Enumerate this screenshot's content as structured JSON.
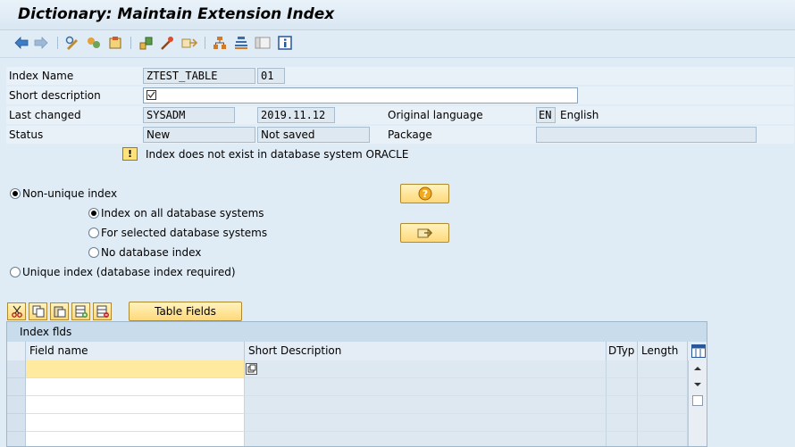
{
  "window": {
    "title": "Dictionary: Maintain Extension Index"
  },
  "toolbar": {
    "icons": [
      "back-icon",
      "forward-icon",
      "display-change-icon",
      "other-object-icon",
      "active-inactive-icon",
      "check-icon",
      "activate-icon",
      "where-used-icon",
      "object-list-icon",
      "navigation-window-icon",
      "display-toggle-icon",
      "info-icon"
    ]
  },
  "form": {
    "index_name_label": "Index Name",
    "index_name_value": "ZTEST_TABLE",
    "index_id_value": "01",
    "short_desc_label": "Short description",
    "short_desc_value": "",
    "last_changed_label": "Last changed",
    "last_changed_user": "SYSADM",
    "last_changed_date": "2019.11.12",
    "orig_lang_label": "Original language",
    "orig_lang_code": "EN",
    "orig_lang_name": "English",
    "status_label": "Status",
    "status_value1": "New",
    "status_value2": "Not saved",
    "package_label": "Package",
    "package_value": "",
    "warning_text": "Index does not exist in database system ORACLE"
  },
  "options": {
    "non_unique_label": "Non-unique index",
    "all_db_label": "Index on all database systems",
    "selected_db_label": "For selected database systems",
    "no_db_label": "No database index",
    "unique_label": "Unique index (database index required)",
    "selected": "non-unique",
    "sub_selected": "all-db"
  },
  "actions": {
    "table_fields_label": "Table Fields"
  },
  "grid": {
    "title": "Index flds",
    "columns": [
      "Field name",
      "Short Description",
      "DTyp",
      "Length"
    ],
    "rows": [
      {
        "field_name": "",
        "short_description": "",
        "dtyp": "",
        "length": ""
      },
      {
        "field_name": "",
        "short_description": "",
        "dtyp": "",
        "length": ""
      },
      {
        "field_name": "",
        "short_description": "",
        "dtyp": "",
        "length": ""
      },
      {
        "field_name": "",
        "short_description": "",
        "dtyp": "",
        "length": ""
      },
      {
        "field_name": "",
        "short_description": "",
        "dtyp": "",
        "length": ""
      }
    ]
  },
  "colors": {
    "background": "#dfebf5",
    "button": "#ffd97a",
    "highlight_row": "#ffeaa0"
  }
}
